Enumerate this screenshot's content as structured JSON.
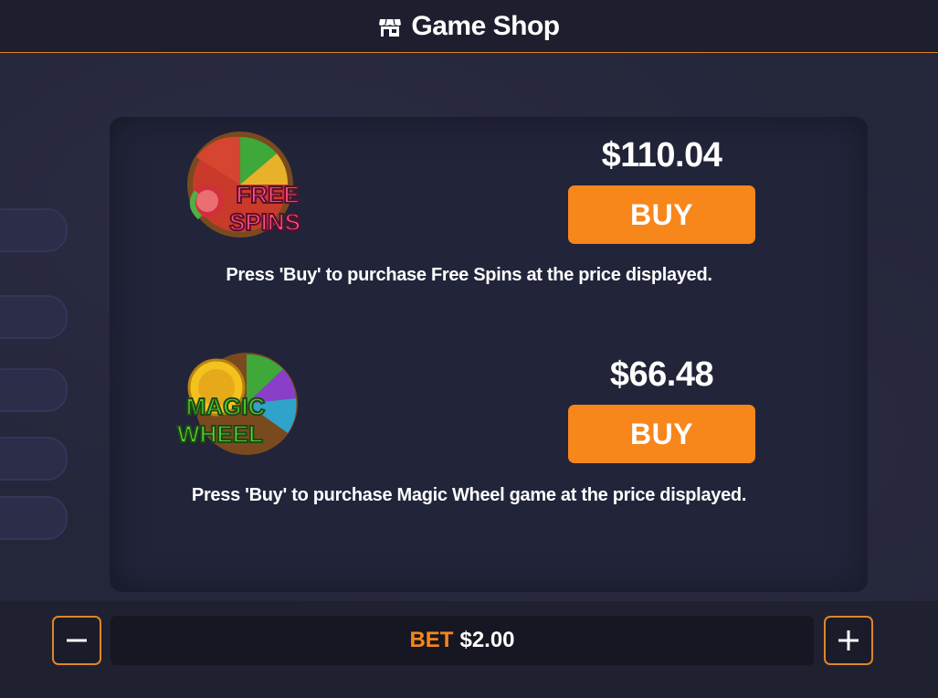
{
  "header": {
    "title": "Game Shop",
    "icon": "shop-icon"
  },
  "items": [
    {
      "logo_line1": "FREE",
      "logo_line2": "SPINS",
      "price": "$110.04",
      "buy_label": "BUY",
      "description": "Press 'Buy' to purchase Free Spins at the price displayed."
    },
    {
      "logo_line1": "MAGIC",
      "logo_line2": "WHEEL",
      "price": "$66.48",
      "buy_label": "BUY",
      "description": "Press 'Buy' to purchase Magic Wheel game at the price displayed."
    }
  ],
  "bet": {
    "label": "BET",
    "value": "$2.00"
  },
  "colors": {
    "accent": "#f7861b",
    "background": "#1f2130",
    "header_border": "#e1842a"
  }
}
